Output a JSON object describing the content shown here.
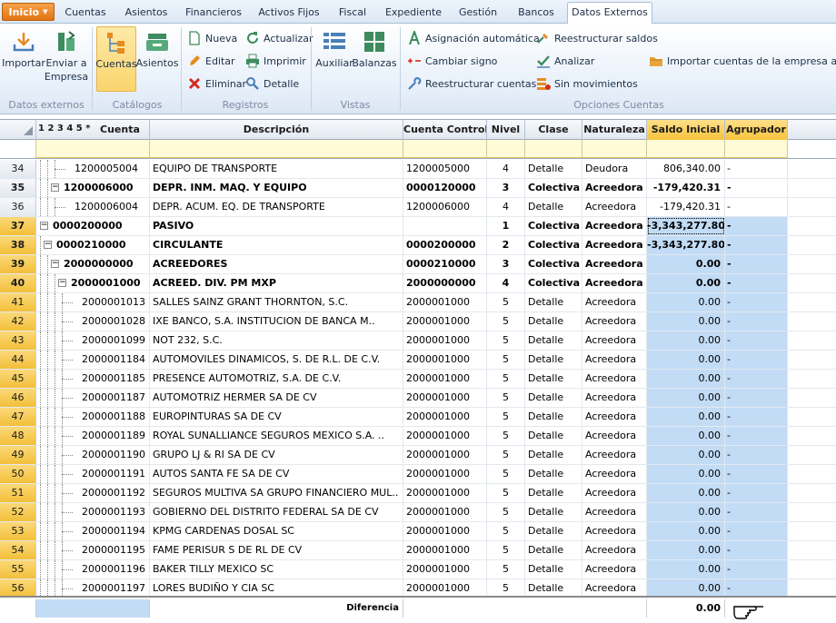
{
  "ribbon": {
    "start_label": "Inicio",
    "tabs": [
      "Cuentas",
      "Asientos",
      "Financieros",
      "Activos Fijos",
      "Fiscal",
      "Expediente",
      "Gestión",
      "Bancos",
      "Datos Externos"
    ],
    "active_tab": "Datos Externos",
    "groups": {
      "datos_externos": {
        "label": "Datos externos",
        "importar": "Importar",
        "enviar_1": "Enviar a",
        "enviar_2": "Empresa"
      },
      "catalogos": {
        "label": "Catálogos",
        "cuentas": "Cuentas",
        "asientos": "Asientos"
      },
      "registros": {
        "label": "Registros",
        "nueva": "Nueva",
        "editar": "Editar",
        "eliminar": "Eliminar",
        "actualizar": "Actualizar",
        "imprimir": "Imprimir",
        "detalle": "Detalle"
      },
      "vistas": {
        "label": "Vistas",
        "auxiliar": "Auxiliar",
        "balanzas": "Balanzas"
      },
      "opciones": {
        "label": "Opciones Cuentas",
        "asignacion": "Asignación automática",
        "cambiar_signo": "Cambiar signo",
        "reestructurar_cuentas": "Reestructurar cuentas",
        "reestructurar_saldos": "Reestructurar saldos",
        "analizar": "Analizar",
        "sin_movimientos": "Sin movimientos",
        "importar_cuentas": "Importar cuentas de la empresa actual"
      }
    }
  },
  "grid": {
    "levels_label": "1 2 3 4 5 *",
    "columns": {
      "cuenta": "Cuenta",
      "descripcion": "Descripción",
      "cuenta_control": "Cuenta Control",
      "nivel": "Nivel",
      "clase": "Clase",
      "naturaleza": "Naturaleza",
      "saldo_inicial": "Saldo Inicial",
      "agrupador": "Agrupador"
    },
    "rows": [
      {
        "n": "34",
        "cuenta": "1200005004",
        "descripcion": "EQUIPO DE TRANSPORTE",
        "control": "1200005000",
        "nivel": "4",
        "clase": "Detalle",
        "naturaleza": "Deudora",
        "saldo": "806,340.00",
        "agrupador": "-"
      },
      {
        "n": "35",
        "cuenta": "1200006000",
        "descripcion": "DEPR. INM. MAQ. Y EQUIPO",
        "control": "0000120000",
        "nivel": "3",
        "clase": "Colectiva",
        "naturaleza": "Acreedora",
        "saldo": "-179,420.31",
        "agrupador": "-"
      },
      {
        "n": "36",
        "cuenta": "1200006004",
        "descripcion": "DEPR. ACUM. EQ. DE TRANSPORTE",
        "control": "1200006000",
        "nivel": "4",
        "clase": "Detalle",
        "naturaleza": "Acreedora",
        "saldo": "-179,420.31",
        "agrupador": "-"
      },
      {
        "n": "37",
        "cuenta": "0000200000",
        "descripcion": "PASIVO",
        "control": "",
        "nivel": "1",
        "clase": "Colectiva",
        "naturaleza": "Acreedora",
        "saldo": "-3,343,277.80",
        "agrupador": "-"
      },
      {
        "n": "38",
        "cuenta": "0000210000",
        "descripcion": "CIRCULANTE",
        "control": "0000200000",
        "nivel": "2",
        "clase": "Colectiva",
        "naturaleza": "Acreedora",
        "saldo": "-3,343,277.80",
        "agrupador": "-"
      },
      {
        "n": "39",
        "cuenta": "2000000000",
        "descripcion": "ACREEDORES",
        "control": "0000210000",
        "nivel": "3",
        "clase": "Colectiva",
        "naturaleza": "Acreedora",
        "saldo": "0.00",
        "agrupador": "-"
      },
      {
        "n": "40",
        "cuenta": "2000001000",
        "descripcion": "ACREED. DIV. PM MXP",
        "control": "2000000000",
        "nivel": "4",
        "clase": "Colectiva",
        "naturaleza": "Acreedora",
        "saldo": "0.00",
        "agrupador": "-"
      },
      {
        "n": "41",
        "cuenta": "2000001013",
        "descripcion": "SALLES SAINZ GRANT THORNTON, S.C.",
        "control": "2000001000",
        "nivel": "5",
        "clase": "Detalle",
        "naturaleza": "Acreedora",
        "saldo": "0.00",
        "agrupador": "-"
      },
      {
        "n": "42",
        "cuenta": "2000001028",
        "descripcion": "IXE BANCO, S.A. INSTITUCION DE BANCA M..",
        "control": "2000001000",
        "nivel": "5",
        "clase": "Detalle",
        "naturaleza": "Acreedora",
        "saldo": "0.00",
        "agrupador": "-"
      },
      {
        "n": "43",
        "cuenta": "2000001099",
        "descripcion": "NOT 232, S.C.",
        "control": "2000001000",
        "nivel": "5",
        "clase": "Detalle",
        "naturaleza": "Acreedora",
        "saldo": "0.00",
        "agrupador": "-"
      },
      {
        "n": "44",
        "cuenta": "2000001184",
        "descripcion": "AUTOMOVILES DINAMICOS, S. DE R.L. DE C.V.",
        "control": "2000001000",
        "nivel": "5",
        "clase": "Detalle",
        "naturaleza": "Acreedora",
        "saldo": "0.00",
        "agrupador": "-"
      },
      {
        "n": "45",
        "cuenta": "2000001185",
        "descripcion": "PRESENCE AUTOMOTRIZ, S.A. DE C.V.",
        "control": "2000001000",
        "nivel": "5",
        "clase": "Detalle",
        "naturaleza": "Acreedora",
        "saldo": "0.00",
        "agrupador": "-"
      },
      {
        "n": "46",
        "cuenta": "2000001187",
        "descripcion": "AUTOMOTRIZ HERMER SA DE CV",
        "control": "2000001000",
        "nivel": "5",
        "clase": "Detalle",
        "naturaleza": "Acreedora",
        "saldo": "0.00",
        "agrupador": "-"
      },
      {
        "n": "47",
        "cuenta": "2000001188",
        "descripcion": "EUROPINTURAS SA DE CV",
        "control": "2000001000",
        "nivel": "5",
        "clase": "Detalle",
        "naturaleza": "Acreedora",
        "saldo": "0.00",
        "agrupador": "-"
      },
      {
        "n": "48",
        "cuenta": "2000001189",
        "descripcion": "ROYAL SUNALLIANCE SEGUROS MEXICO S.A. ..",
        "control": "2000001000",
        "nivel": "5",
        "clase": "Detalle",
        "naturaleza": "Acreedora",
        "saldo": "0.00",
        "agrupador": "-"
      },
      {
        "n": "49",
        "cuenta": "2000001190",
        "descripcion": "GRUPO LJ & RI SA DE CV",
        "control": "2000001000",
        "nivel": "5",
        "clase": "Detalle",
        "naturaleza": "Acreedora",
        "saldo": "0.00",
        "agrupador": "-"
      },
      {
        "n": "50",
        "cuenta": "2000001191",
        "descripcion": "AUTOS SANTA FE SA DE CV",
        "control": "2000001000",
        "nivel": "5",
        "clase": "Detalle",
        "naturaleza": "Acreedora",
        "saldo": "0.00",
        "agrupador": "-"
      },
      {
        "n": "51",
        "cuenta": "2000001192",
        "descripcion": "SEGUROS MULTIVA SA GRUPO FINANCIERO MUL..",
        "control": "2000001000",
        "nivel": "5",
        "clase": "Detalle",
        "naturaleza": "Acreedora",
        "saldo": "0.00",
        "agrupador": "-"
      },
      {
        "n": "52",
        "cuenta": "2000001193",
        "descripcion": "GOBIERNO DEL DISTRITO FEDERAL SA DE CV",
        "control": "2000001000",
        "nivel": "5",
        "clase": "Detalle",
        "naturaleza": "Acreedora",
        "saldo": "0.00",
        "agrupador": "-"
      },
      {
        "n": "53",
        "cuenta": "2000001194",
        "descripcion": "KPMG CARDENAS DOSAL SC",
        "control": "2000001000",
        "nivel": "5",
        "clase": "Detalle",
        "naturaleza": "Acreedora",
        "saldo": "0.00",
        "agrupador": "-"
      },
      {
        "n": "54",
        "cuenta": "2000001195",
        "descripcion": "FAME PERISUR S DE RL DE CV",
        "control": "2000001000",
        "nivel": "5",
        "clase": "Detalle",
        "naturaleza": "Acreedora",
        "saldo": "0.00",
        "agrupador": "-"
      },
      {
        "n": "55",
        "cuenta": "2000001196",
        "descripcion": "BAKER TILLY MEXICO SC",
        "control": "2000001000",
        "nivel": "5",
        "clase": "Detalle",
        "naturaleza": "Acreedora",
        "saldo": "0.00",
        "agrupador": "-"
      },
      {
        "n": "56",
        "cuenta": "2000001197",
        "descripcion": "LORES BUDIÑO Y CIA SC",
        "control": "2000001000",
        "nivel": "5",
        "clase": "Detalle",
        "naturaleza": "Acreedora",
        "saldo": "0.00",
        "agrupador": "-"
      }
    ],
    "footer": {
      "label": "Diferencia",
      "value": "0.00"
    }
  },
  "colors": {
    "accent": "#f7c23c",
    "selected_blue": "#c2dcf6",
    "start": "#e07512"
  }
}
